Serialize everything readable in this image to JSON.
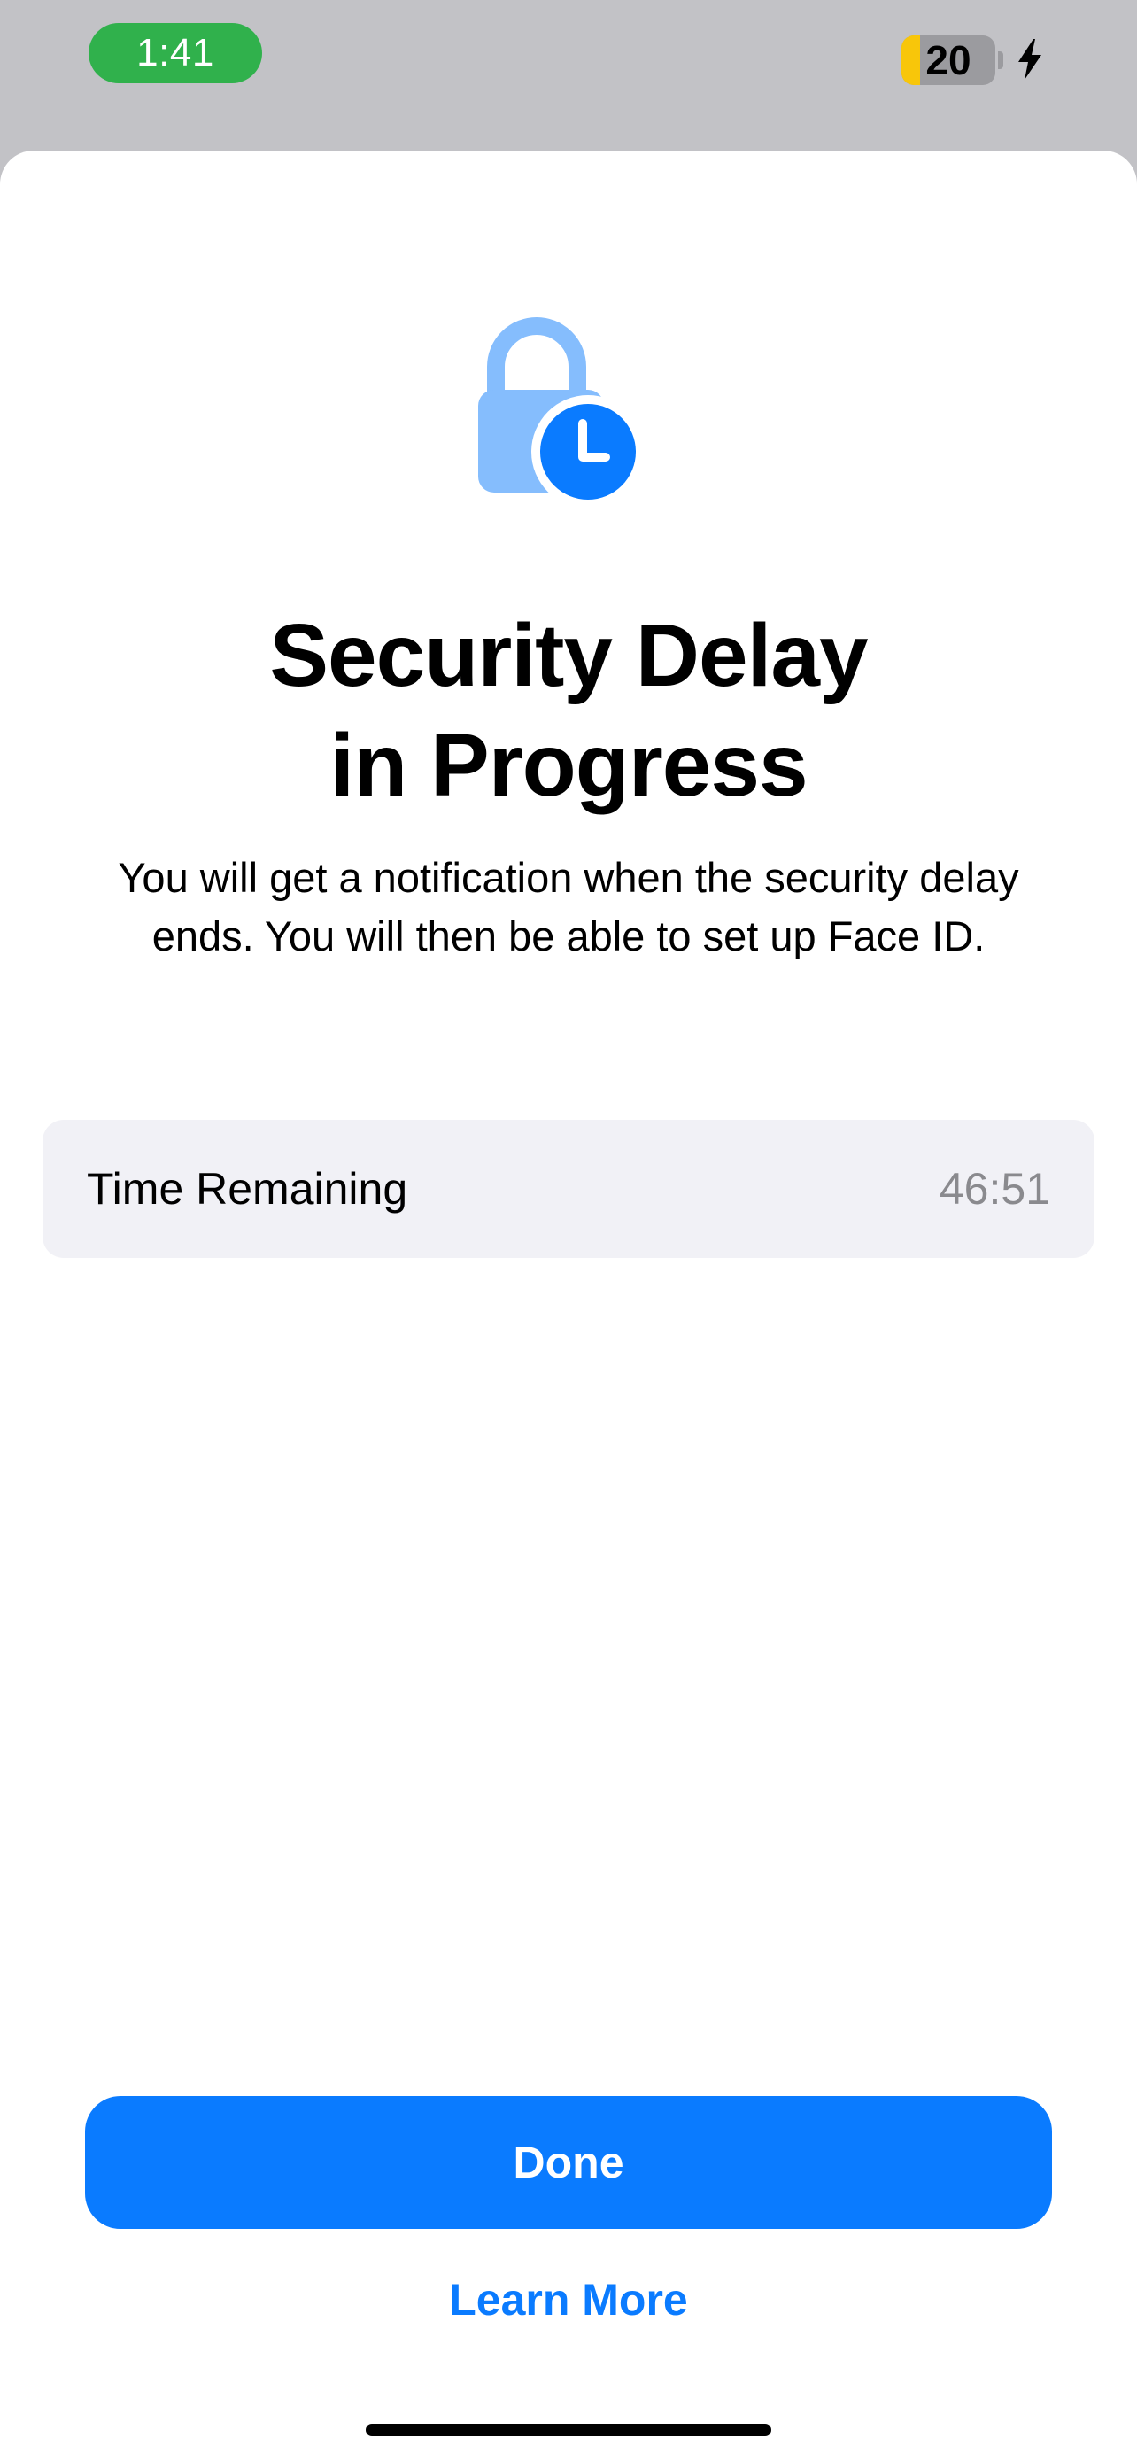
{
  "status_bar": {
    "time": "1:41",
    "battery_level": "20",
    "battery_fraction": 0.2,
    "colors": {
      "time_pill": "#30b14c",
      "battery_fill": "#f8c60a"
    }
  },
  "icons": {
    "header_icon": "lock-with-clock-icon",
    "charging_icon": "bolt-icon"
  },
  "content": {
    "title_line1": "Security Delay",
    "title_line2": "in Progress",
    "description": "You will get a notification when the security delay ends. You will then be able to set up Face ID."
  },
  "time_card": {
    "label": "Time Remaining",
    "value": "46:51"
  },
  "actions": {
    "done_label": "Done",
    "learn_more_label": "Learn More"
  },
  "colors": {
    "accent": "#0a7bff",
    "lock_light": "#85bdfd",
    "card_background": "#f1f1f6"
  }
}
